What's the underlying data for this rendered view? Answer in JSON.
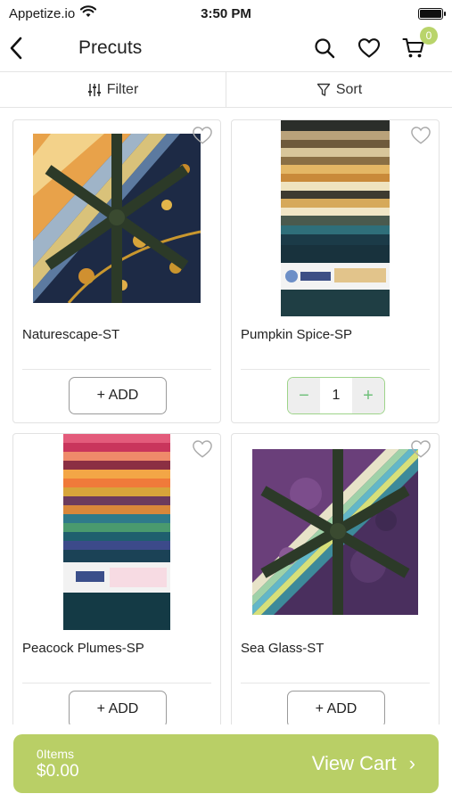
{
  "status_bar": {
    "carrier": "Appetize.io",
    "time": "3:50 PM"
  },
  "header": {
    "title": "Precuts",
    "cart_count": "0"
  },
  "toolbar": {
    "filter_label": "Filter",
    "sort_label": "Sort"
  },
  "products": [
    {
      "name": "Naturescape-ST",
      "action": "+ ADD",
      "in_cart": false
    },
    {
      "name": "Pumpkin Spice-SP",
      "quantity": "1",
      "in_cart": true,
      "minus": "−",
      "plus": "+"
    },
    {
      "name": "Peacock Plumes-SP",
      "action": "+ ADD",
      "in_cart": false
    },
    {
      "name": "Sea Glass-ST",
      "action": "+ ADD",
      "in_cart": false
    }
  ],
  "cart_bar": {
    "items": "0Items",
    "total": "$0.00",
    "label": "View Cart",
    "chevron": "›"
  },
  "colors": {
    "accent": "#b9cf66",
    "badge": "#b9d46b",
    "stepper_border": "#9ed48a",
    "stepper_icon": "#6fc07a"
  }
}
